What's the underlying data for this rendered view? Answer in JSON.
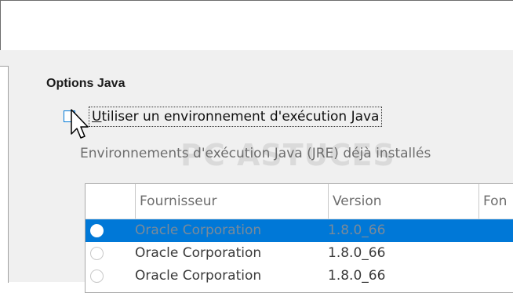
{
  "options": {
    "section_title": "Options Java",
    "use_jre_label": "Utiliser un environnement d'exécution Java",
    "use_jre_checked": false,
    "jre_list_label_pre": "Environnements d'exécution ",
    "jre_list_label_mnemonic": "J",
    "jre_list_label_post": "ava (JRE) déjà installés"
  },
  "watermark": "PC ASTUCES",
  "table": {
    "columns": [
      "Fournisseur",
      "Version",
      "Fon"
    ],
    "rows": [
      {
        "vendor": "Oracle Corporation",
        "version": "1.8.0_66",
        "selected": true
      },
      {
        "vendor": "Oracle Corporation",
        "version": "1.8.0_66",
        "selected": false
      },
      {
        "vendor": "Oracle Corporation",
        "version": "1.8.0_66",
        "selected": false
      }
    ]
  },
  "colors": {
    "selection": "#0078d7",
    "checkbox_border": "#0078d7",
    "panel_bg": "#f0f0f0"
  }
}
